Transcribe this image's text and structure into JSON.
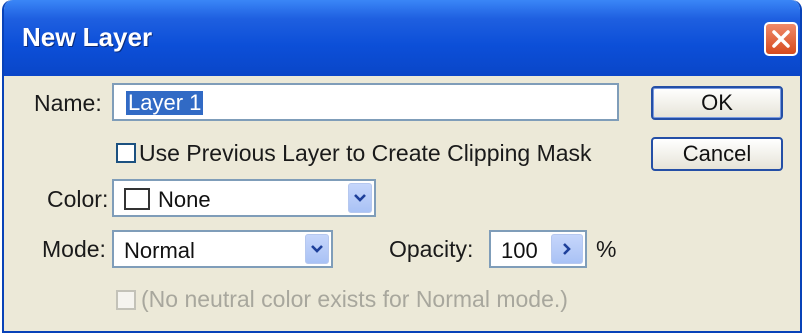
{
  "dialog": {
    "title": "New Layer",
    "close_icon": "close-icon"
  },
  "name_field": {
    "label": "Name:",
    "value": "Layer 1"
  },
  "clipping_mask": {
    "label": "Use Previous Layer to Create Clipping Mask",
    "checked": false
  },
  "color_field": {
    "label": "Color:",
    "value": "None",
    "swatch_color": "#ffffff"
  },
  "mode_field": {
    "label": "Mode:",
    "value": "Normal"
  },
  "opacity_field": {
    "label": "Opacity:",
    "value": "100",
    "unit": "%"
  },
  "neutral_color": {
    "label": "(No neutral color exists for Normal mode.)",
    "enabled": false
  },
  "buttons": {
    "ok": "OK",
    "cancel": "Cancel"
  },
  "colors": {
    "title_bar": "#0c4fd8",
    "dialog_bg": "#ece9d8",
    "selection": "#316ac5",
    "close_button": "#d64a1e"
  }
}
